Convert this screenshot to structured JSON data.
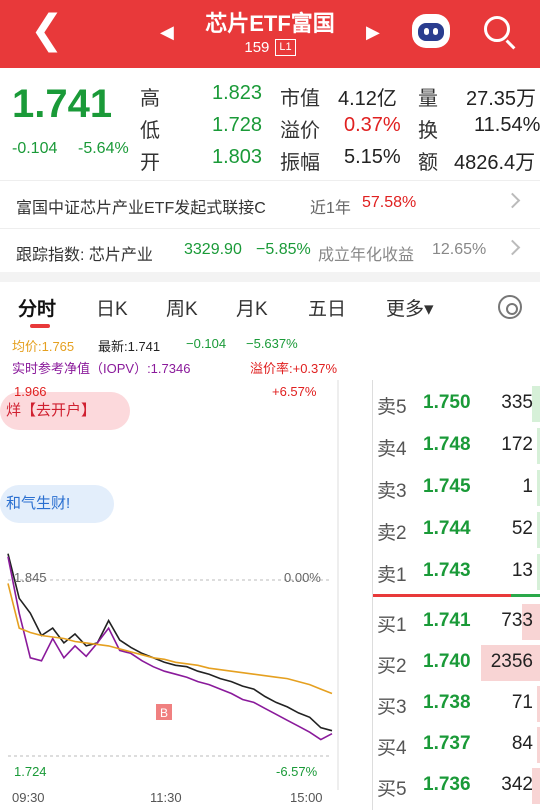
{
  "header": {
    "back_icon": "chevron-left-icon",
    "prev_icon": "triangle-left-icon",
    "next_icon": "triangle-right-icon",
    "title": "芯片ETF富国",
    "code": "159",
    "level_tag": "L1",
    "assistant_icon": "robot-icon",
    "search_icon": "search-icon"
  },
  "quote": {
    "price": "1.741",
    "change": "-0.104",
    "change_pct": "-5.64%",
    "high_label": "高",
    "high": "1.823",
    "low_label": "低",
    "low": "1.728",
    "open_label": "开",
    "open": "1.803",
    "mktcap_label": "市值",
    "mktcap": "4.12亿",
    "premium_label": "溢价",
    "premium": "0.37%",
    "amp_label": "振幅",
    "amp": "5.15%",
    "vol_label": "量",
    "vol": "27.35万",
    "turnover_label": "换",
    "turnover": "11.54%",
    "amount_label": "额",
    "amount": "4826.4万"
  },
  "fund_row": {
    "name": "富国中证芯片产业ETF发起式联接C",
    "period": "近1年",
    "return": "57.58%"
  },
  "index_row": {
    "label": "跟踪指数: 芯片产业",
    "value": "3329.90",
    "change": "−5.85%",
    "annual_label": "成立年化收益",
    "annual": "12.65%"
  },
  "tabs": [
    "分时",
    "日K",
    "周K",
    "月K",
    "五日",
    "更多▾"
  ],
  "settings_icon": "gear-icon",
  "info": {
    "avg": "均价:1.765",
    "latest": "最新:1.741",
    "chg": "−0.104",
    "chg_pct": "−5.637%",
    "iopv": "实时参考净值（IOPV）:1.7346",
    "premium": "溢价率:+0.37%"
  },
  "chart_data": {
    "type": "line",
    "y_ticks": [
      "1.966",
      "1.845",
      "1.724"
    ],
    "pct_ticks": [
      "+6.57%",
      "0.00%",
      "-6.57%"
    ],
    "x_ticks": [
      "09:30",
      "11:30",
      "15:00"
    ],
    "ylim": [
      1.724,
      1.966
    ],
    "marker": "B",
    "series": [
      {
        "color": "#222222",
        "values": [
          1.86,
          1.83,
          1.82,
          1.805,
          1.81,
          1.8,
          1.806,
          1.798,
          1.8,
          1.815,
          1.802,
          1.797,
          1.793,
          1.79,
          1.787,
          1.785,
          1.784,
          1.781,
          1.779,
          1.776,
          1.774,
          1.771,
          1.769,
          1.764,
          1.76,
          1.757,
          1.753,
          1.75,
          1.743,
          1.741
        ]
      },
      {
        "color": "#8a1a9b",
        "values": [
          1.858,
          1.82,
          1.79,
          1.788,
          1.803,
          1.79,
          1.798,
          1.791,
          1.8,
          1.81,
          1.795,
          1.793,
          1.788,
          1.784,
          1.781,
          1.779,
          1.777,
          1.774,
          1.772,
          1.769,
          1.766,
          1.762,
          1.76,
          1.756,
          1.752,
          1.748,
          1.744,
          1.74,
          1.735,
          1.739
        ]
      },
      {
        "color": "#e5a020",
        "values": [
          1.84,
          1.81,
          1.807,
          1.805,
          1.804,
          1.803,
          1.801,
          1.8,
          1.799,
          1.798,
          1.796,
          1.794,
          1.792,
          1.79,
          1.789,
          1.787,
          1.786,
          1.785,
          1.783,
          1.782,
          1.781,
          1.78,
          1.779,
          1.778,
          1.777,
          1.776,
          1.774,
          1.772,
          1.769,
          1.766
        ]
      }
    ]
  },
  "promo": {
    "pill1": "烊【去开户】",
    "pill2": "和气生财!"
  },
  "order_book": {
    "asks": [
      {
        "side": "卖5",
        "price": "1.750",
        "vol": "335"
      },
      {
        "side": "卖4",
        "price": "1.748",
        "vol": "172"
      },
      {
        "side": "卖3",
        "price": "1.745",
        "vol": "1"
      },
      {
        "side": "卖2",
        "price": "1.744",
        "vol": "52"
      },
      {
        "side": "卖1",
        "price": "1.743",
        "vol": "13"
      }
    ],
    "bids": [
      {
        "side": "买1",
        "price": "1.741",
        "vol": "733"
      },
      {
        "side": "买2",
        "price": "1.740",
        "vol": "2356"
      },
      {
        "side": "买3",
        "price": "1.738",
        "vol": "71"
      },
      {
        "side": "买4",
        "price": "1.737",
        "vol": "84"
      },
      {
        "side": "买5",
        "price": "1.736",
        "vol": "342"
      }
    ]
  }
}
